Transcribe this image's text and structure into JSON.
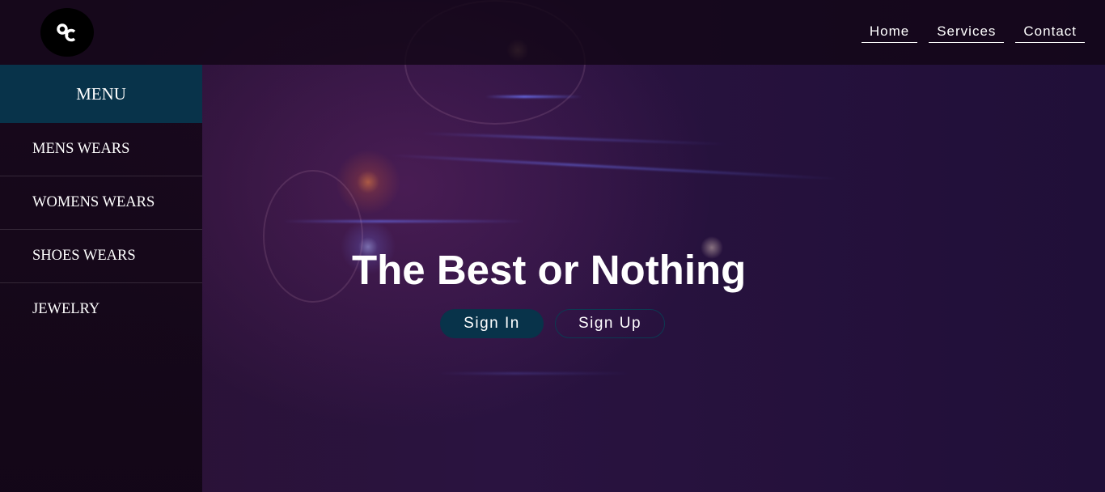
{
  "header": {
    "logo_icon": "oc-monogram-logo",
    "nav": [
      {
        "label": "Home"
      },
      {
        "label": "Services"
      },
      {
        "label": "Contact"
      }
    ]
  },
  "sidebar": {
    "title": "MENU",
    "items": [
      {
        "label": "MENS WEARS"
      },
      {
        "label": "WOMENS WEARS"
      },
      {
        "label": "SHOES WEARS"
      },
      {
        "label": "JEWELRY"
      }
    ]
  },
  "hero": {
    "title": "The Best or Nothing",
    "signin_label": "Sign In",
    "signup_label": "Sign Up"
  },
  "colors": {
    "accent": "#08334a",
    "text": "#ffffff",
    "background": "#200f38"
  }
}
